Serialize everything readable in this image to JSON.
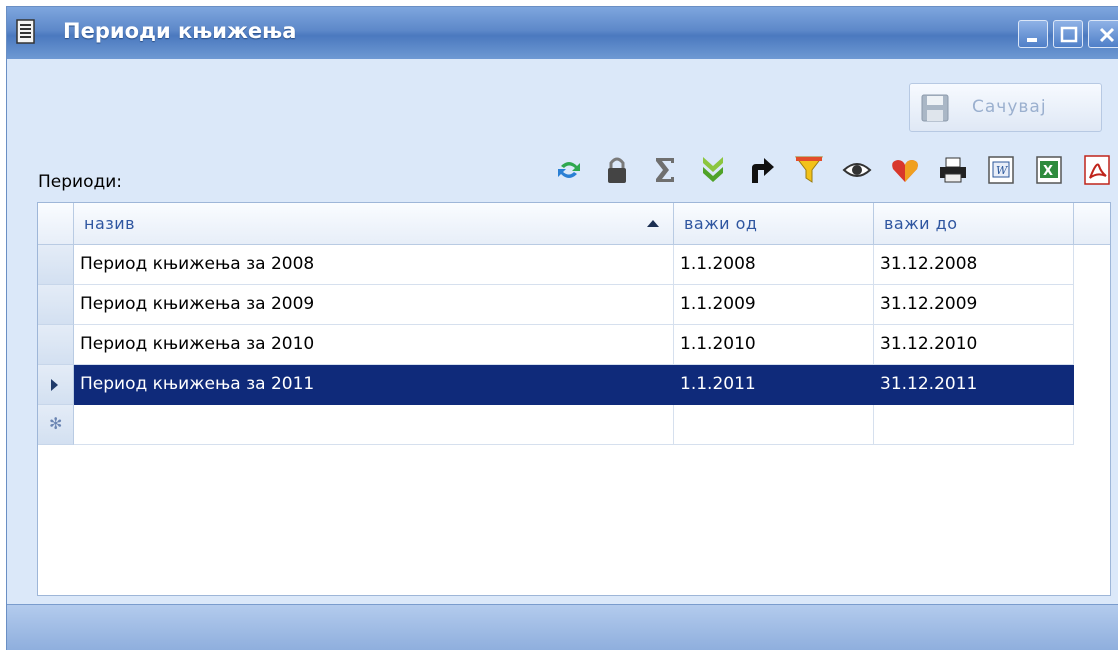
{
  "window": {
    "title": "Периоди књижења",
    "icon": "document-icon",
    "controls": [
      "minimize-icon",
      "maximize-icon",
      "close-icon"
    ]
  },
  "save_button": {
    "label": "Сачувај",
    "icon": "floppy-disk-icon",
    "enabled": false
  },
  "periods_label": "Периоди:",
  "toolbar_icons": [
    "refresh-icon",
    "lock-icon",
    "sum-icon",
    "expand-down-icon",
    "redirect-arrow-icon",
    "filter-icon",
    "eye-icon",
    "heart-icon",
    "print-icon",
    "word-export-icon",
    "excel-export-icon",
    "pdf-export-icon"
  ],
  "grid": {
    "columns": [
      {
        "label": "назив",
        "sorted": "ascending"
      },
      {
        "label": "важи од"
      },
      {
        "label": "важи до"
      }
    ],
    "rows": [
      {
        "name": "Период књижења за 2008",
        "from": "1.1.2008",
        "to": "31.12.2008",
        "selected": false
      },
      {
        "name": "Период књижења за 2009",
        "from": "1.1.2009",
        "to": "31.12.2009",
        "selected": false
      },
      {
        "name": "Период књижења за 2010",
        "from": "1.1.2010",
        "to": "31.12.2010",
        "selected": false
      },
      {
        "name": "Период књижења за 2011",
        "from": "1.1.2011",
        "to": "31.12.2011",
        "selected": true
      }
    ],
    "new_row_marker": "✻"
  },
  "colors": {
    "selection": "#0f2a7a",
    "header_text": "#2f56a0",
    "window_bg": "#dbe8f9",
    "titlebar": "#5d88c9"
  }
}
